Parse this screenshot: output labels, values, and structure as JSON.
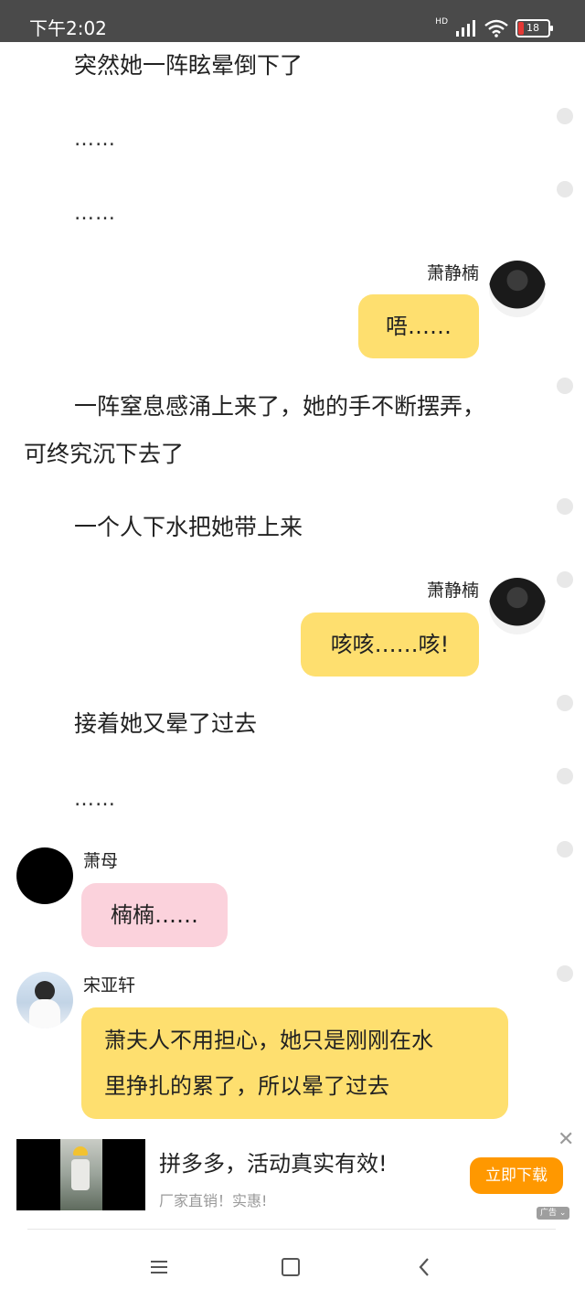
{
  "status_bar": {
    "time": "下午2:02",
    "network_label": "HD",
    "battery_level": "18",
    "battery_color": "#e53935"
  },
  "story": [
    {
      "kind": "narration",
      "text": "突然她一阵眩晕倒下了"
    },
    {
      "kind": "narration",
      "text": "……"
    },
    {
      "kind": "narration",
      "text": "……"
    },
    {
      "kind": "message",
      "speaker": "萧静楠",
      "text": "唔……"
    },
    {
      "kind": "narration",
      "text": "一阵窒息感涌上来了，她的手不断摆弄，可终究沉下去了"
    },
    {
      "kind": "narration",
      "text": "一个人下水把她带上来"
    },
    {
      "kind": "message",
      "speaker": "萧静楠",
      "text": "咳咳……咳!"
    },
    {
      "kind": "narration",
      "text": "接着她又晕了过去"
    },
    {
      "kind": "narration",
      "text": "……"
    },
    {
      "kind": "message",
      "speaker": "萧母",
      "text": "楠楠……"
    },
    {
      "kind": "message",
      "speaker": "宋亚轩",
      "text": "萧夫人不用担心，她只是刚刚在水里挣扎的累了，所以晕了过去"
    }
  ],
  "story_lines": {
    "line5_b": "可终究沉下去了",
    "line5_a": "一阵窒息感涌上来了，她的手不断摆弄，",
    "msg11_a": "萧夫人不用担心，她只是刚刚在水",
    "msg11_b": "里挣扎的累了，所以晕了过去"
  },
  "colors": {
    "bubble_yellow": "#fedf6f",
    "bubble_pink": "#fbd2dc",
    "cta_orange": "#ff9800"
  },
  "ad": {
    "title": "拼多多，活动真实有效!",
    "subtitle": "厂家直销！实惠!",
    "cta": "立即下载",
    "close_icon": "close-icon",
    "tag": "广告"
  },
  "nav": {
    "menu_icon": "menu-icon",
    "home_icon": "home-icon",
    "back_icon": "back-icon"
  }
}
